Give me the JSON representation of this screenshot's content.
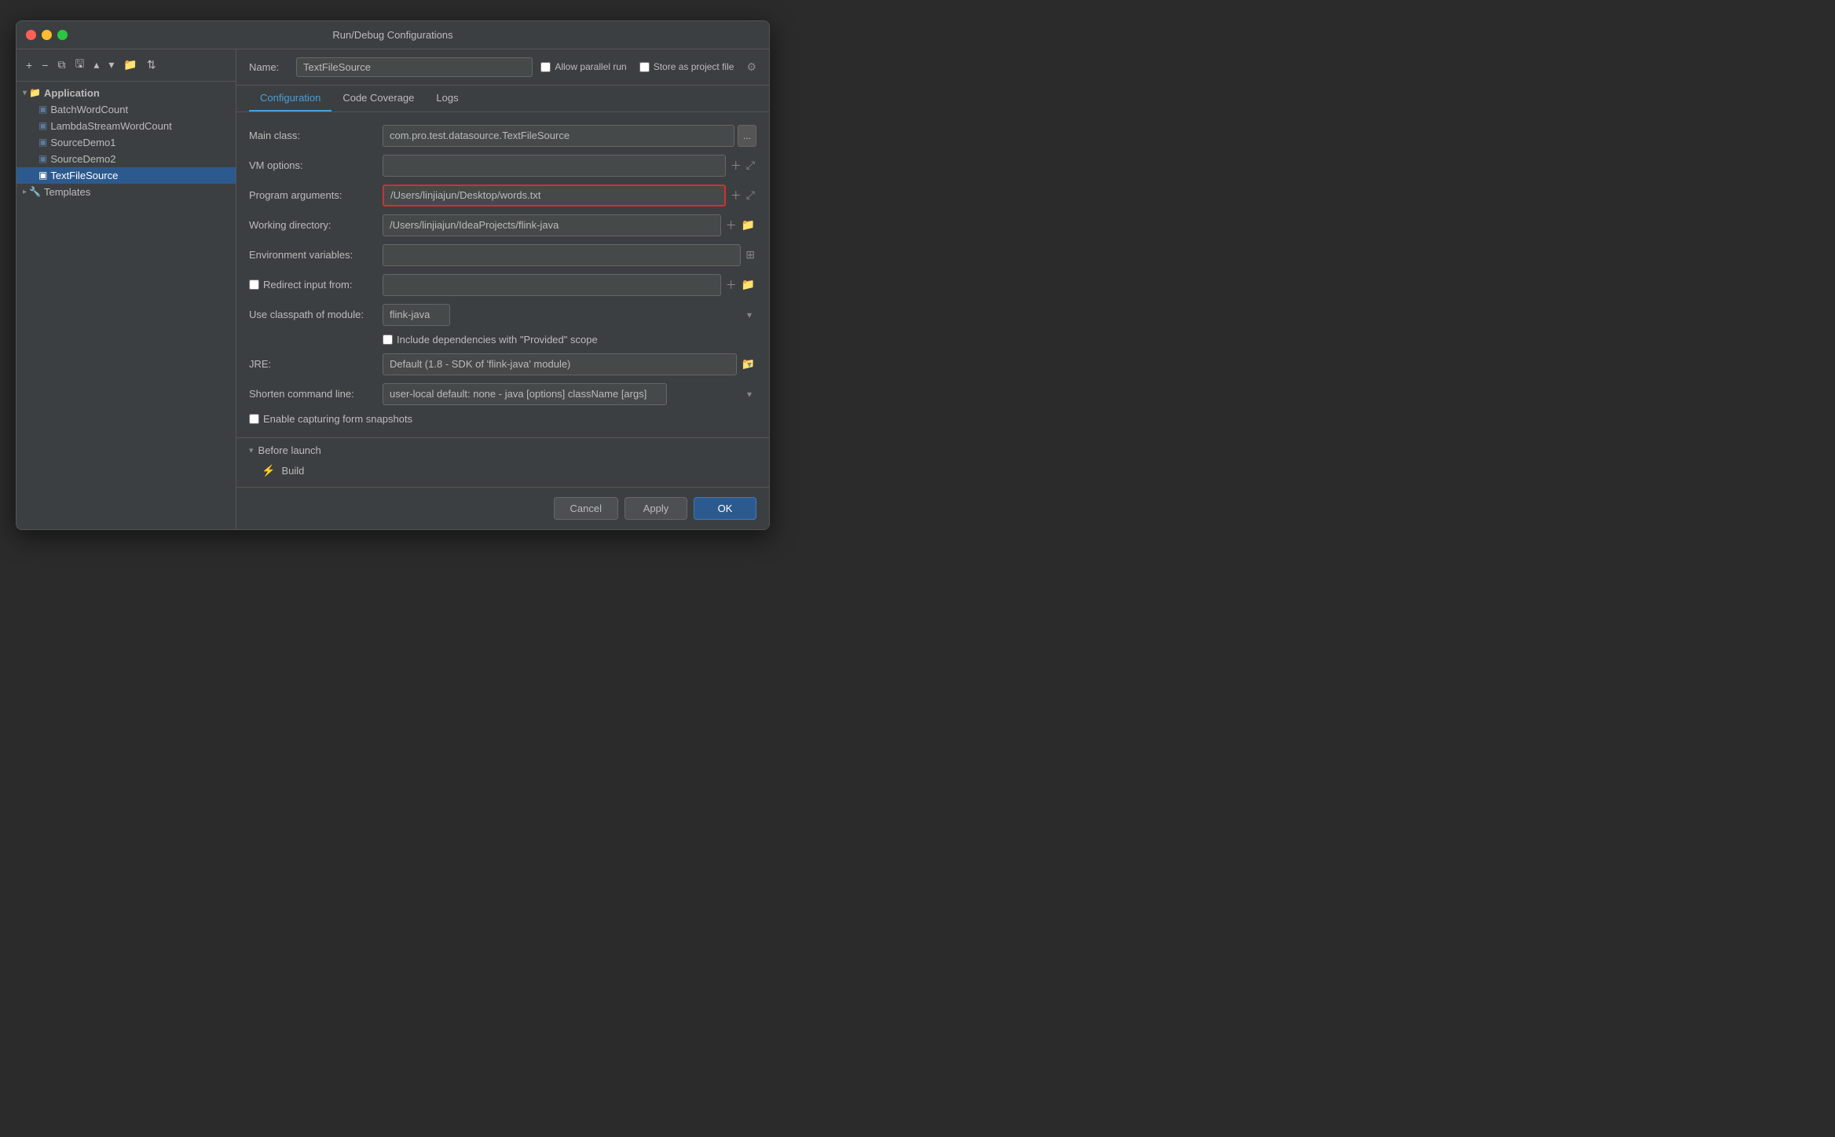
{
  "dialog": {
    "title": "Run/Debug Configurations"
  },
  "toolbar": {
    "add": "+",
    "remove": "−",
    "copy": "⧉",
    "save": "💾",
    "move_up": "▲",
    "move_down": "▼",
    "folder": "📁",
    "sort": "⇅"
  },
  "tree": {
    "items": [
      {
        "id": "application",
        "label": "Application",
        "level": 0,
        "type": "folder",
        "expanded": true
      },
      {
        "id": "batchwordcount",
        "label": "BatchWordCount",
        "level": 1,
        "type": "config"
      },
      {
        "id": "lambdastreamwordcount",
        "label": "LambdaStreamWordCount",
        "level": 1,
        "type": "config"
      },
      {
        "id": "sourcedemo1",
        "label": "SourceDemo1",
        "level": 1,
        "type": "config"
      },
      {
        "id": "sourcedemo2",
        "label": "SourceDemo2",
        "level": 1,
        "type": "config"
      },
      {
        "id": "textfilesource",
        "label": "TextFileSource",
        "level": 1,
        "type": "config",
        "selected": true
      },
      {
        "id": "templates",
        "label": "Templates",
        "level": 0,
        "type": "folder",
        "expanded": false
      }
    ]
  },
  "config": {
    "name_label": "Name:",
    "name_value": "TextFileSource",
    "allow_parallel_label": "Allow parallel run",
    "store_project_label": "Store as project file",
    "allow_parallel_checked": false,
    "store_project_checked": false
  },
  "tabs": [
    {
      "id": "configuration",
      "label": "Configuration",
      "active": true
    },
    {
      "id": "code_coverage",
      "label": "Code Coverage",
      "active": false
    },
    {
      "id": "logs",
      "label": "Logs",
      "active": false
    }
  ],
  "form": {
    "main_class_label": "Main class:",
    "main_class_value": "com.pro.test.datasource.TextFileSource",
    "vm_options_label": "VM options:",
    "vm_options_value": "",
    "program_args_label": "Program arguments:",
    "program_args_value": "/Users/linjiajun/Desktop/words.txt",
    "working_dir_label": "Working directory:",
    "working_dir_value": "/Users/linjiajun/IdeaProjects/flink-java",
    "env_vars_label": "Environment variables:",
    "env_vars_value": "",
    "redirect_input_label": "Redirect input from:",
    "redirect_input_value": "",
    "redirect_checked": false,
    "classpath_label": "Use classpath of module:",
    "classpath_value": "flink-java",
    "include_deps_label": "Include dependencies with \"Provided\" scope",
    "include_deps_checked": false,
    "jre_label": "JRE:",
    "jre_value": "Default (1.8 - SDK of 'flink-java' module)",
    "shorten_cmd_label": "Shorten command line:",
    "shorten_cmd_value": "user-local default: none - java [options] className [args]",
    "enable_snapshots_label": "Enable capturing form snapshots",
    "enable_snapshots_checked": false
  },
  "before_launch": {
    "title": "Before launch",
    "build_label": "Build"
  },
  "footer": {
    "cancel_label": "Cancel",
    "apply_label": "Apply",
    "ok_label": "OK"
  }
}
